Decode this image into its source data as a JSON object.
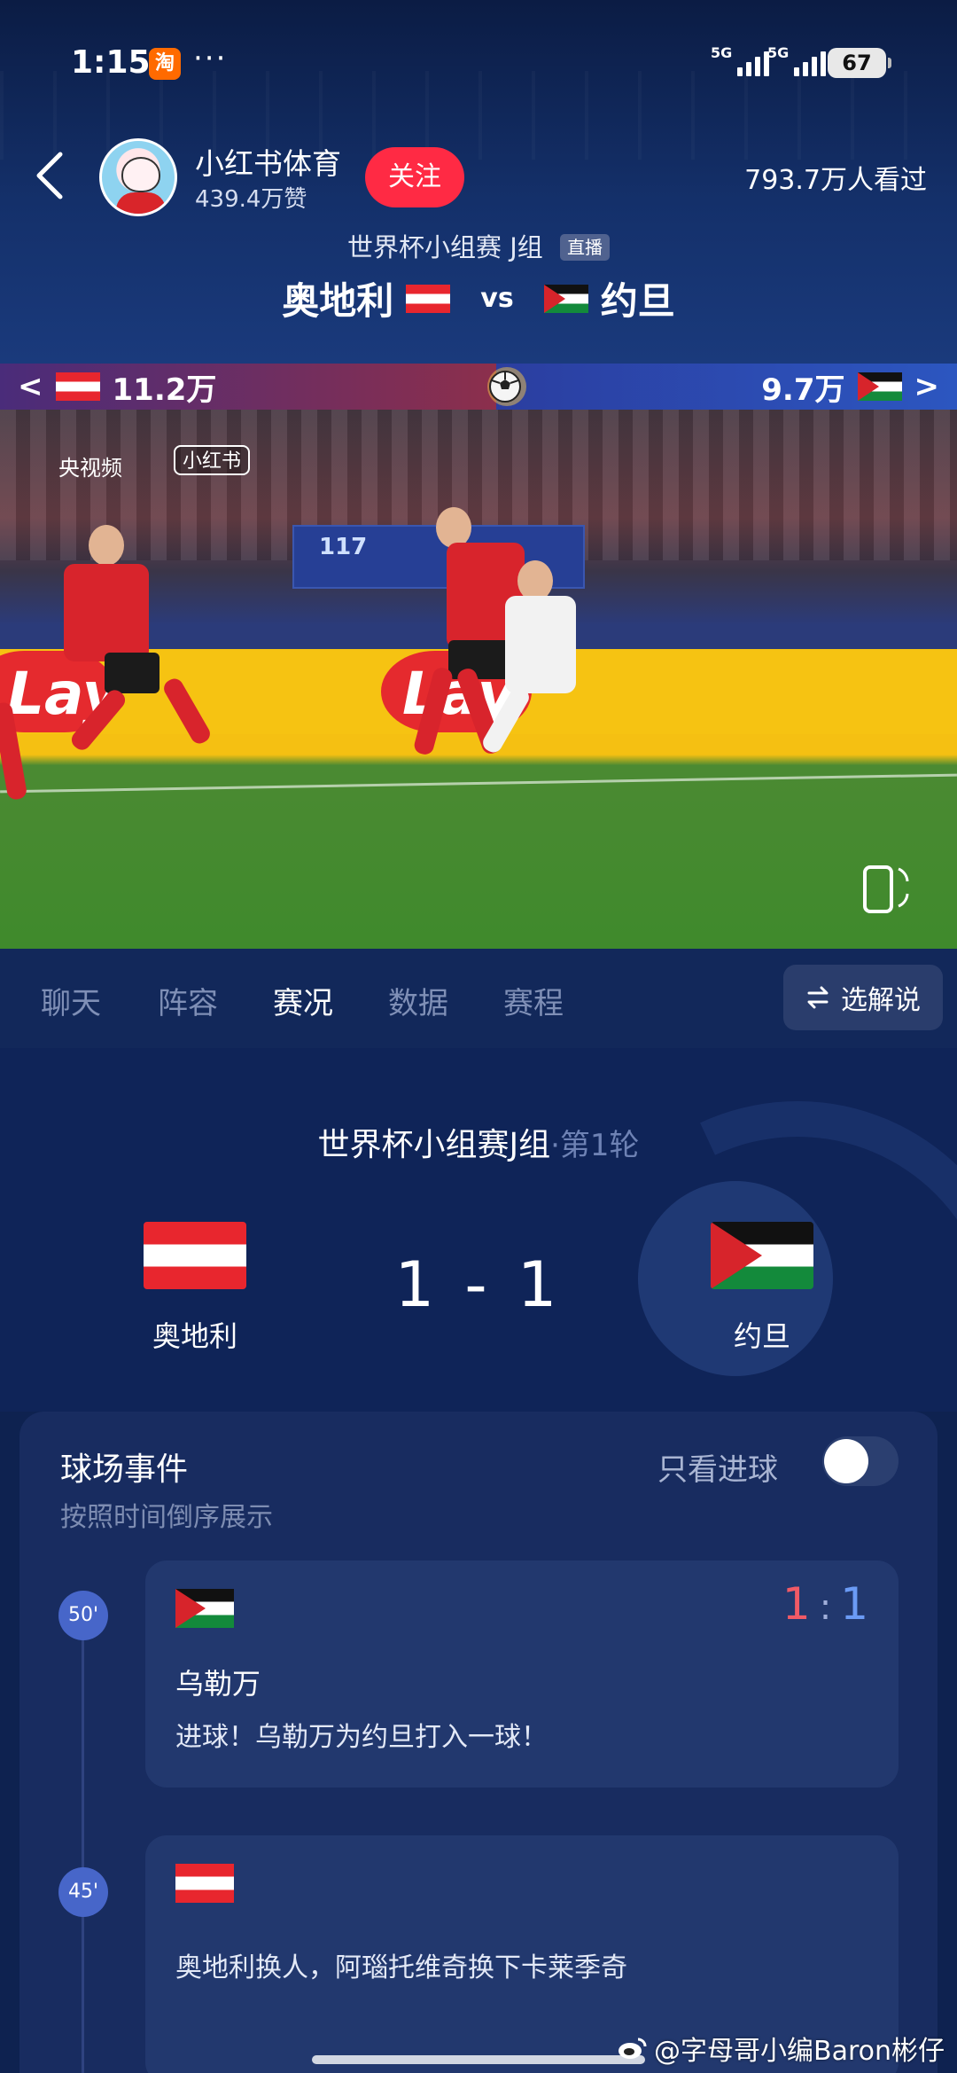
{
  "status_bar": {
    "time": "1:15",
    "app_badge": "淘",
    "dots": "···",
    "network_1": "5G",
    "network_2": "5G",
    "battery": "67"
  },
  "header": {
    "channel_name": "小红书体育",
    "channel_likes": "439.4万赞",
    "follow_label": "关注",
    "viewers": "793.7万人看过",
    "match_subtitle": "世界杯小组赛 J组",
    "live_tag": "直播",
    "home_team": "奥地利",
    "vs": "vs",
    "away_team": "约旦"
  },
  "support_bar": {
    "home_count": "11.2万",
    "away_count": "9.7万",
    "left_arrow": "<",
    "right_arrow": ">"
  },
  "video": {
    "broadcaster_logo": "央视频",
    "platform_logo": "小红书",
    "board_number": "117",
    "ad_text": "Lay"
  },
  "tabs": {
    "items": [
      "聊天",
      "阵容",
      "赛况",
      "数据",
      "赛程"
    ],
    "active": "赛况",
    "commentary_label": "选解说"
  },
  "scoreboard": {
    "title": "世界杯小组赛J组",
    "round": "·第1轮",
    "home_team": "奥地利",
    "away_team": "约旦",
    "score": "1 - 1"
  },
  "events": {
    "title": "球场事件",
    "subtitle": "按照时间倒序展示",
    "goal_filter_label": "只看进球",
    "goal_filter_on": false,
    "items": [
      {
        "minute": "50'",
        "team": "约旦",
        "score_home": "1",
        "score_sep": ":",
        "score_away": "1",
        "player": "乌勒万",
        "description": "进球！乌勒万为约旦打入一球！"
      },
      {
        "minute": "45'",
        "team": "奥地利",
        "description": "奥地利换人，阿瑙托维奇换下卡莱季奇"
      }
    ]
  },
  "watermark": "@字母哥小编Baron彬仔",
  "colors": {
    "background": "#0e2250",
    "follow_button": "#ff2a44",
    "home_score": "#f05a66",
    "away_score": "#6b9bf5",
    "minute_badge": "#4766c9"
  }
}
